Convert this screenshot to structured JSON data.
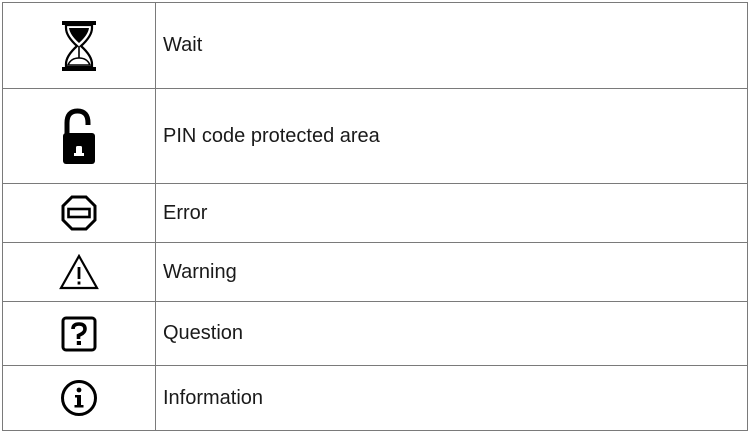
{
  "rows": [
    {
      "icon": "hourglass-icon",
      "label": "Wait"
    },
    {
      "icon": "padlock-open-icon",
      "label": "PIN code protected area"
    },
    {
      "icon": "error-stop-icon",
      "label": "Error"
    },
    {
      "icon": "warning-triangle-icon",
      "label": "Warning"
    },
    {
      "icon": "question-box-icon",
      "label": "Question"
    },
    {
      "icon": "information-circle-icon",
      "label": "Information"
    }
  ],
  "colors": {
    "border": "#7a7a7a",
    "text": "#1a1a1a",
    "icon": "#000000"
  }
}
